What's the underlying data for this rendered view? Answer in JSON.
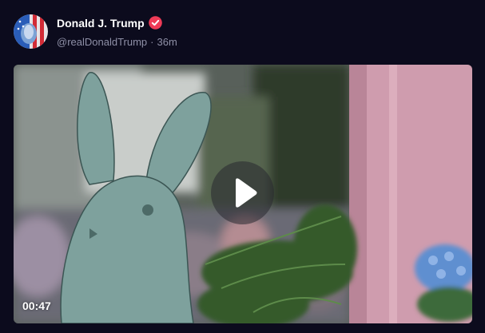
{
  "post": {
    "author": {
      "display_name": "Donald J. Trump",
      "handle": "@realDonaldTrump",
      "separator": "·",
      "time_ago": "36m",
      "verified": true,
      "verified_color": "#ef3b57"
    },
    "video": {
      "duration": "00:47",
      "play_icon": "play-icon"
    }
  },
  "colors": {
    "background": "#0c0b1d",
    "name": "#ffffff",
    "meta": "#8f90a7"
  }
}
